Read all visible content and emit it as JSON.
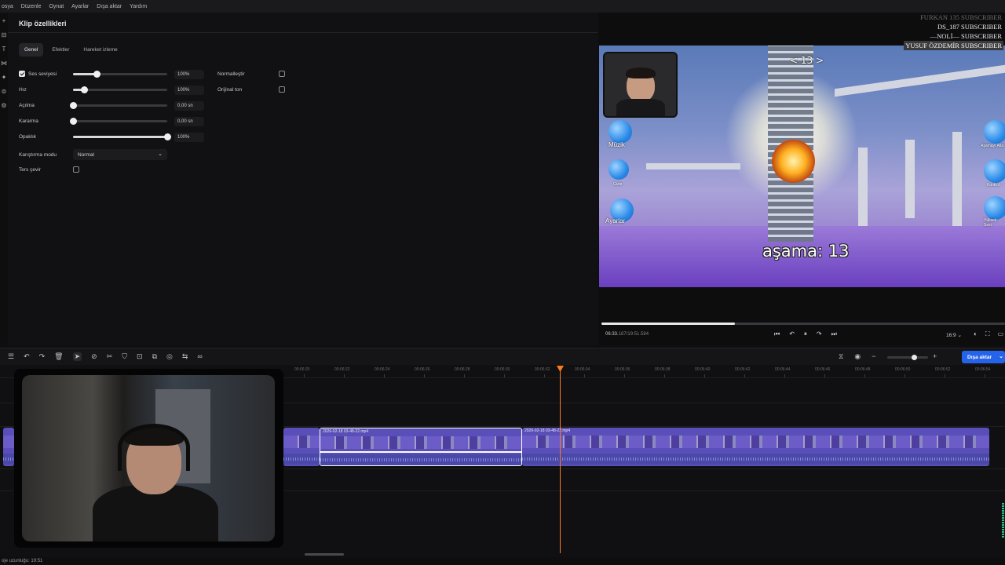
{
  "menu": [
    "osya",
    "Düzenle",
    "Oynat",
    "Ayarlar",
    "Dışa aktar",
    "Yardım"
  ],
  "left_tools": [
    "+",
    "⊟",
    "T",
    "⋈",
    "✦",
    "⊜",
    "⚙"
  ],
  "props": {
    "title": "Klip özellikleri",
    "tabs": [
      "Genel",
      "Efektler",
      "Hareket izleme"
    ],
    "active_tab": "Genel",
    "rows": {
      "volume": {
        "label": "Ses seviyesi",
        "value": "100%",
        "checked": true,
        "level": 0.25
      },
      "speed": {
        "label": "Hız",
        "value": "100%",
        "level": 0.12
      },
      "fade_in": {
        "label": "Açılma",
        "value": "0,00 sn",
        "level": 0.0
      },
      "fade_out": {
        "label": "Kararma",
        "value": "0,00 sn",
        "level": 0.0
      },
      "opacity": {
        "label": "Opaklık",
        "value": "100%",
        "level": 1.0
      },
      "blend": {
        "label": "Karıştırma modu",
        "value": "Normal"
      },
      "reverse": {
        "label": "Ters çevir",
        "checked": false
      },
      "normalize": {
        "label": "Normalleştir",
        "checked": false
      },
      "original_tone": {
        "label": "Orijinal ton",
        "checked": false
      }
    }
  },
  "preview": {
    "subscribers": [
      {
        "text": "FURKAN 135  SUBSCRIBER",
        "style": "faint"
      },
      {
        "text": "DS_187  SUBSCRIBER",
        "style": "normal"
      },
      {
        "text": "—NOLİ—  SUBSCRIBER",
        "style": "normal"
      },
      {
        "text": "YUSUF ÖZDEMİR  SUBSCRIBER",
        "style": "hl"
      }
    ],
    "stage_text": "aşama: 13",
    "stage_nav": "<  13  >",
    "bubbles": [
      "Müzik",
      "Gizle",
      "Ayarlar",
      "Aşamayı Atla",
      "Kontrol",
      "Yüksek Sesi"
    ],
    "time_current": "06:33.",
    "time_frac": "187",
    "time_total": "/19:51.584",
    "progress": 0.33,
    "controls": [
      "⏮",
      "↶",
      "⏸",
      "↷",
      "⏭"
    ],
    "ratio": "16:9  ⌄",
    "right_controls": [
      "◐",
      "⛶",
      "▭"
    ]
  },
  "timeline": {
    "tools": [
      "☰",
      "↶",
      "↷",
      "🗑",
      "➤",
      "⊘",
      "✂",
      "⛉",
      "⊡",
      "⧉",
      "◎",
      "⇆",
      "∞"
    ],
    "selected_tool_index": 4,
    "right_tools": [
      "⧖",
      "◉",
      "−",
      "+"
    ],
    "zoom_level": 0.65,
    "export_label": "Dışa aktar",
    "ticks": [
      "00:06:20",
      "00:06:22",
      "00:06:24",
      "00:06:26",
      "00:06:28",
      "00:06:30",
      "00:06:32",
      "00:06:34",
      "00:06:36",
      "00:06:38",
      "00:06:40",
      "00:06:42",
      "00:06:44",
      "00:06:46",
      "00:06:48",
      "00:06:50",
      "00:06:52",
      "00:06:54"
    ],
    "clips": [
      {
        "name": "2026-02-18 03-48-22.mp4",
        "selected": true
      },
      {
        "name": "2026-02-18 03-48-22.mp4",
        "selected": false
      }
    ]
  },
  "status": "oje uzunluğu: 19:51"
}
